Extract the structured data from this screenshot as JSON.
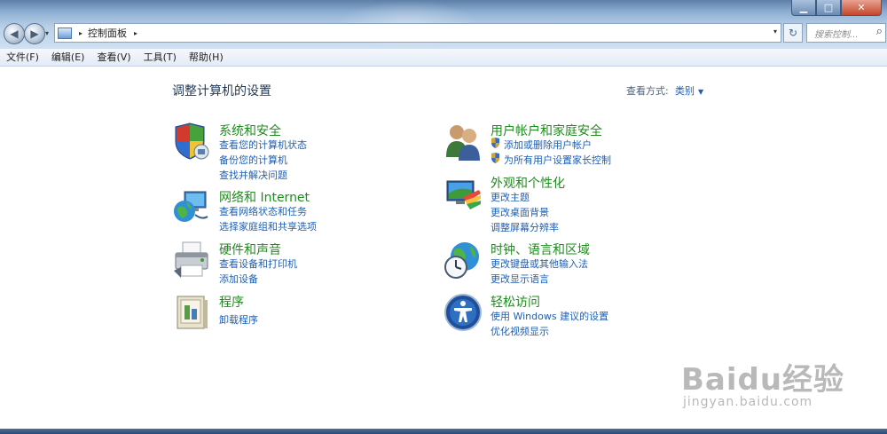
{
  "window": {
    "minimize": "▁",
    "maximize": "□",
    "close": "✕"
  },
  "nav": {
    "back": "◀",
    "forward": "▶",
    "dropdown": "▾"
  },
  "address": {
    "crumb": "控制面板",
    "sep": "▸",
    "dropdown": "▾"
  },
  "refresh_glyph": "↻",
  "search": {
    "placeholder": "搜索控制...",
    "icon": "search-icon"
  },
  "menu": [
    "文件(F)",
    "编辑(E)",
    "查看(V)",
    "工具(T)",
    "帮助(H)"
  ],
  "heading": "调整计算机的设置",
  "view_by": {
    "label": "查看方式:",
    "value": "类别"
  },
  "categories": [
    {
      "title": "系统和安全",
      "icon": "security-shield-icon",
      "links": [
        "查看您的计算机状态",
        "备份您的计算机",
        "查找并解决问题"
      ]
    },
    {
      "title": "网络和 Internet",
      "icon": "network-globe-icon",
      "links": [
        "查看网络状态和任务",
        "选择家庭组和共享选项"
      ]
    },
    {
      "title": "硬件和声音",
      "icon": "printer-icon",
      "links": [
        "查看设备和打印机",
        "添加设备"
      ]
    },
    {
      "title": "程序",
      "icon": "programs-icon",
      "links": [
        "卸载程序"
      ]
    },
    {
      "title": "用户帐户和家庭安全",
      "icon": "users-icon",
      "links": [
        "添加或删除用户帐户",
        "为所有用户设置家长控制"
      ]
    },
    {
      "title": "外观和个性化",
      "icon": "display-icon",
      "links": [
        "更改主题",
        "更改桌面背景",
        "调整屏幕分辨率"
      ]
    },
    {
      "title": "时钟、语言和区域",
      "icon": "clock-globe-icon",
      "links": [
        "更改键盘或其他输入法",
        "更改显示语言"
      ]
    },
    {
      "title": "轻松访问",
      "icon": "ease-of-access-icon",
      "links": [
        "使用 Windows 建议的设置",
        "优化视频显示"
      ]
    }
  ],
  "watermark": {
    "brand": "Baidu经验",
    "url": "jingyan.baidu.com"
  },
  "colors": {
    "link": "#1f5fb3",
    "category_title": "#1e8c1e",
    "heading": "#1e395b"
  }
}
